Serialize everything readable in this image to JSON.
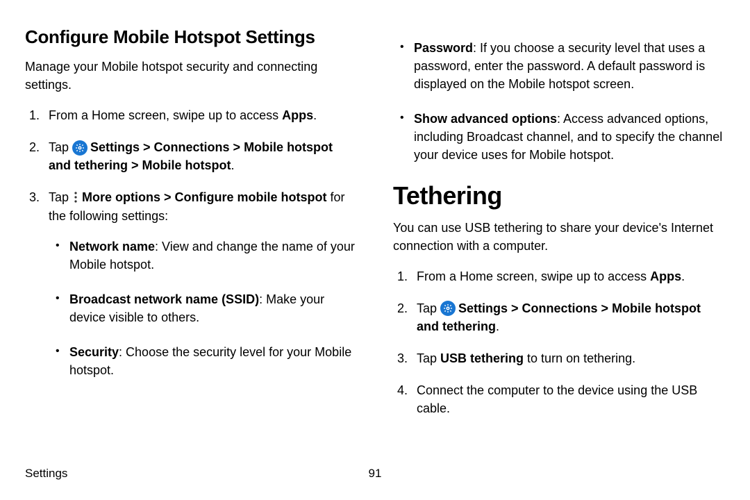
{
  "left": {
    "heading": "Configure Mobile Hotspot Settings",
    "intro": "Manage your Mobile hotspot security and connecting settings.",
    "step1_a": "From a Home screen, swipe up to access ",
    "step1_b": "Apps",
    "step1_c": ".",
    "step2_a": "Tap ",
    "step2_b": "Settings > Connections > Mobile hotspot and tethering > Mobile hotspot",
    "step2_c": ".",
    "step3_a": "Tap ",
    "step3_b": "More options > Configure mobile hotspot",
    "step3_c": " for the following settings:",
    "b1_a": "Network name",
    "b1_b": ": View and change the name of your Mobile hotspot.",
    "b2_a": "Broadcast network name (SSID)",
    "b2_b": ": Make your device visible to others.",
    "b3_a": "Security",
    "b3_b": ": Choose the security level for your Mobile hotspot."
  },
  "right": {
    "top_b1_a": "Password",
    "top_b1_b": ": If you choose a security level that uses a password, enter the password. A default password is displayed on the Mobile hotspot screen.",
    "top_b2_a": "Show advanced options",
    "top_b2_b": ": Access advanced options, including Broadcast channel, and to specify the channel your device uses for Mobile hotspot.",
    "heading": "Tethering",
    "intro": "You can use USB tethering to share your device's Internet connection with a computer.",
    "step1_a": "From a Home screen, swipe up to access ",
    "step1_b": "Apps",
    "step1_c": ".",
    "step2_a": "Tap ",
    "step2_b": "Settings > Connections > Mobile hotspot and tethering",
    "step2_c": ".",
    "step3_a": "Tap ",
    "step3_b": "USB tethering",
    "step3_c": " to turn on tethering.",
    "step4": "Connect the computer to the device using the USB cable."
  },
  "footer": {
    "label": "Settings",
    "page": "91"
  }
}
